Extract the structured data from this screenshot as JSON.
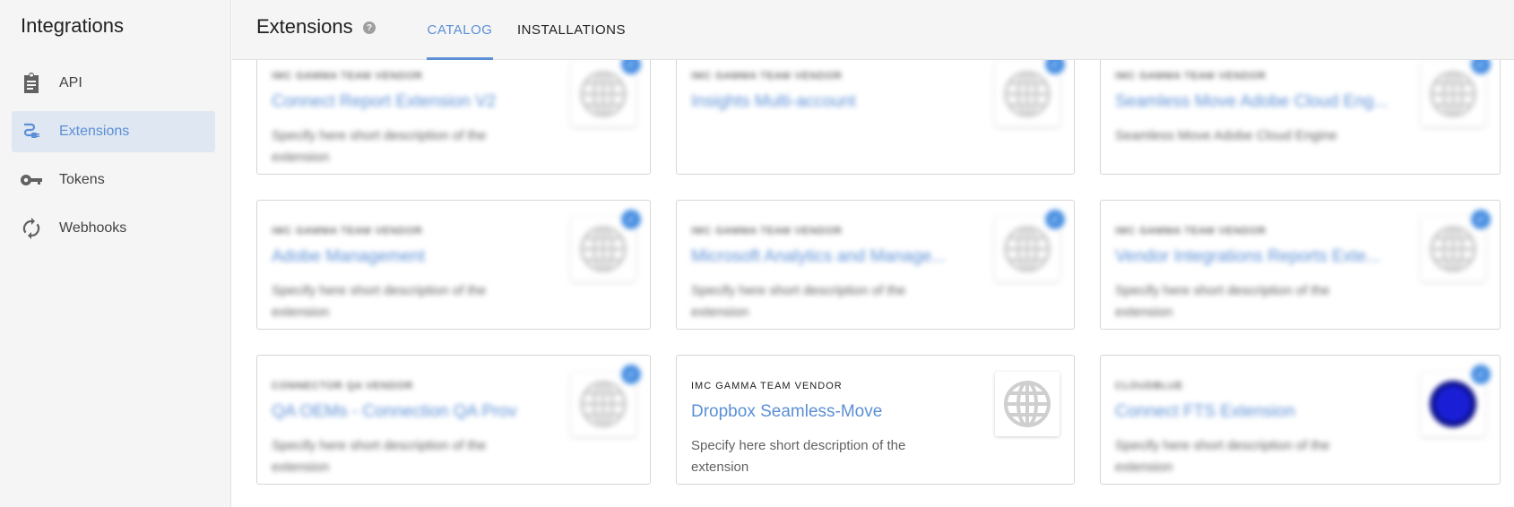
{
  "sidebar": {
    "title": "Integrations",
    "items": [
      {
        "label": "API",
        "icon": "clipboard-icon",
        "active": false
      },
      {
        "label": "Extensions",
        "icon": "plug-icon",
        "active": true
      },
      {
        "label": "Tokens",
        "icon": "key-icon",
        "active": false
      },
      {
        "label": "Webhooks",
        "icon": "sync-icon",
        "active": false
      }
    ]
  },
  "header": {
    "title": "Extensions",
    "help_icon": "?",
    "tabs": [
      {
        "label": "CATALOG",
        "active": true
      },
      {
        "label": "INSTALLATIONS",
        "active": false
      }
    ]
  },
  "colors": {
    "accent": "#5b8fd6",
    "active_nav_bg": "#dfe7f2",
    "badge": "#4a90e2"
  },
  "catalog": {
    "cards": [
      {
        "vendor": "IMC GAMMA TEAM VENDOR",
        "name": "Connect Report Extension V2",
        "description": "Specify here short description of the extension",
        "logo": "globe-icon",
        "badge": "check-icon",
        "blurred": true
      },
      {
        "vendor": "IMC GAMMA TEAM VENDOR",
        "name": "Insights Multi-account",
        "description": "",
        "logo": "globe-icon",
        "badge": "check-icon",
        "blurred": true
      },
      {
        "vendor": "IMC GAMMA TEAM VENDOR",
        "name": "Seamless Move Adobe Cloud Eng...",
        "description": "Seamless Move Adobe Cloud Engine",
        "logo": "globe-icon",
        "badge": "check-icon",
        "blurred": true
      },
      {
        "vendor": "IMC GAMMA TEAM VENDOR",
        "name": "Adobe Management",
        "description": "Specify here short description of the extension",
        "logo": "globe-icon",
        "badge": "check-icon",
        "blurred": true
      },
      {
        "vendor": "IMC GAMMA TEAM VENDOR",
        "name": "Microsoft Analytics and Manage...",
        "description": "Specify here short description of the extension",
        "logo": "globe-icon",
        "badge": "check-icon",
        "blurred": true
      },
      {
        "vendor": "IMC GAMMA TEAM VENDOR",
        "name": "Vendor Integrations Reports Exte...",
        "description": "Specify here short description of the extension",
        "logo": "globe-icon",
        "badge": "check-icon",
        "blurred": true
      },
      {
        "vendor": "CONNECTOR QA VENDOR",
        "name": "QA OEMs - Connection QA Prov",
        "description": "Specify here short description of the extension",
        "logo": "globe-icon",
        "badge": "check-icon",
        "blurred": true
      },
      {
        "vendor": "IMC GAMMA TEAM VENDOR",
        "name": "Dropbox Seamless-Move",
        "description": "Specify here short description of the extension",
        "logo": "globe-icon",
        "badge": "",
        "blurred": false
      },
      {
        "vendor": "CLOUDBLUE",
        "name": "Connect FTS Extension",
        "description": "Specify here short description of the extension",
        "logo": "dropbox-blue-icon",
        "badge": "check-icon",
        "blurred": true
      }
    ]
  }
}
